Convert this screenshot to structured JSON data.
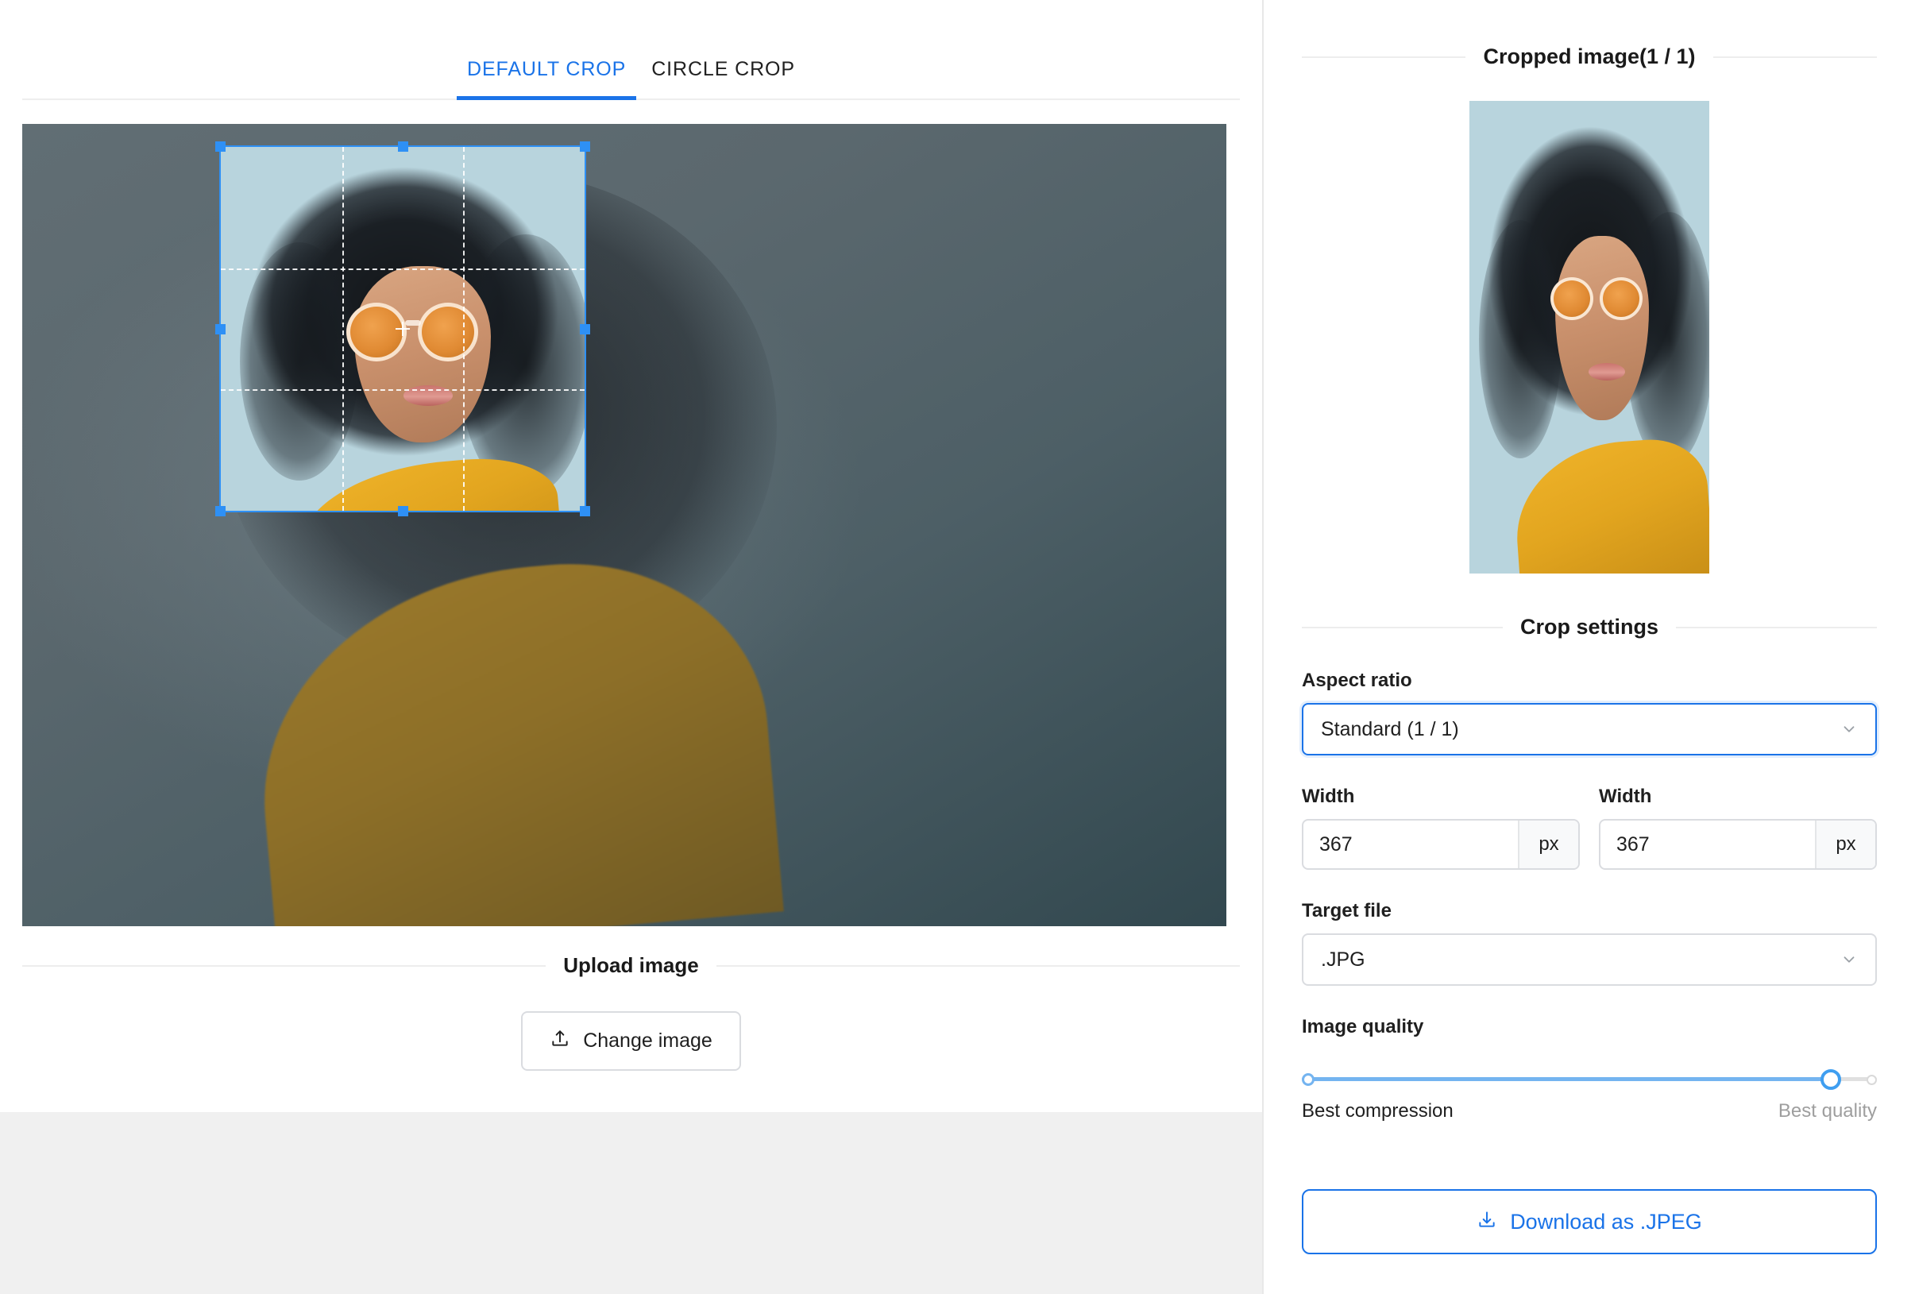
{
  "tabs": [
    {
      "label": "DEFAULT CROP",
      "active": true
    },
    {
      "label": "CIRCLE CROP",
      "active": false
    }
  ],
  "upload": {
    "section_title": "Upload image",
    "change_button": "Change image",
    "upload_icon": "upload-icon"
  },
  "right": {
    "preview_title": "Cropped image(1 / 1)",
    "settings_title": "Crop settings",
    "aspect_ratio": {
      "label": "Aspect ratio",
      "value": "Standard (1 / 1)",
      "chevron_icon": "chevron-down-icon"
    },
    "width_1": {
      "label": "Width",
      "value": "367",
      "unit": "px"
    },
    "width_2": {
      "label": "Width",
      "value": "367",
      "unit": "px"
    },
    "target_file": {
      "label": "Target file",
      "value": ".JPG",
      "chevron_icon": "chevron-down-icon"
    },
    "quality": {
      "label": "Image quality",
      "min_label": "Best compression",
      "max_label": "Best quality",
      "value_percent": 92
    },
    "download_button": {
      "label": "Download as .JPEG",
      "icon": "download-icon"
    }
  },
  "colors": {
    "accent": "#1a73e8",
    "crop_border": "#2e90f5",
    "slider_fill": "#74b4f0",
    "photo_background": "#b8d4dd",
    "overlay_dim": "#5d6a70"
  }
}
